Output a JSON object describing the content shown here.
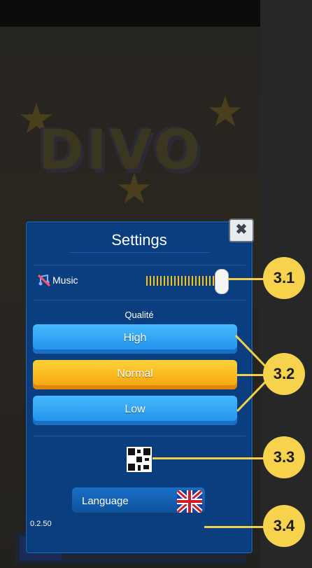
{
  "settings": {
    "title": "Settings",
    "close_icon": "close-icon",
    "music": {
      "label": "Music",
      "icon": "music-off-icon",
      "volume_fraction": 0.82
    },
    "quality": {
      "label": "Qualité",
      "options": [
        {
          "label": "High",
          "selected": false
        },
        {
          "label": "Normal",
          "selected": true
        },
        {
          "label": "Low",
          "selected": false
        }
      ]
    },
    "qr_icon": "qr-code-icon",
    "language": {
      "label": "Language",
      "flag_icon": "uk-flag-icon"
    },
    "version": "0.2.50"
  },
  "callouts": {
    "c1": "3.1",
    "c2": "3.2",
    "c3": "3.3",
    "c4": "3.4"
  },
  "colors": {
    "panel": "#0a3e7e",
    "blue_button": "#2ea2f5",
    "yellow_button": "#f8b81f",
    "callout": "#f7d34d"
  }
}
